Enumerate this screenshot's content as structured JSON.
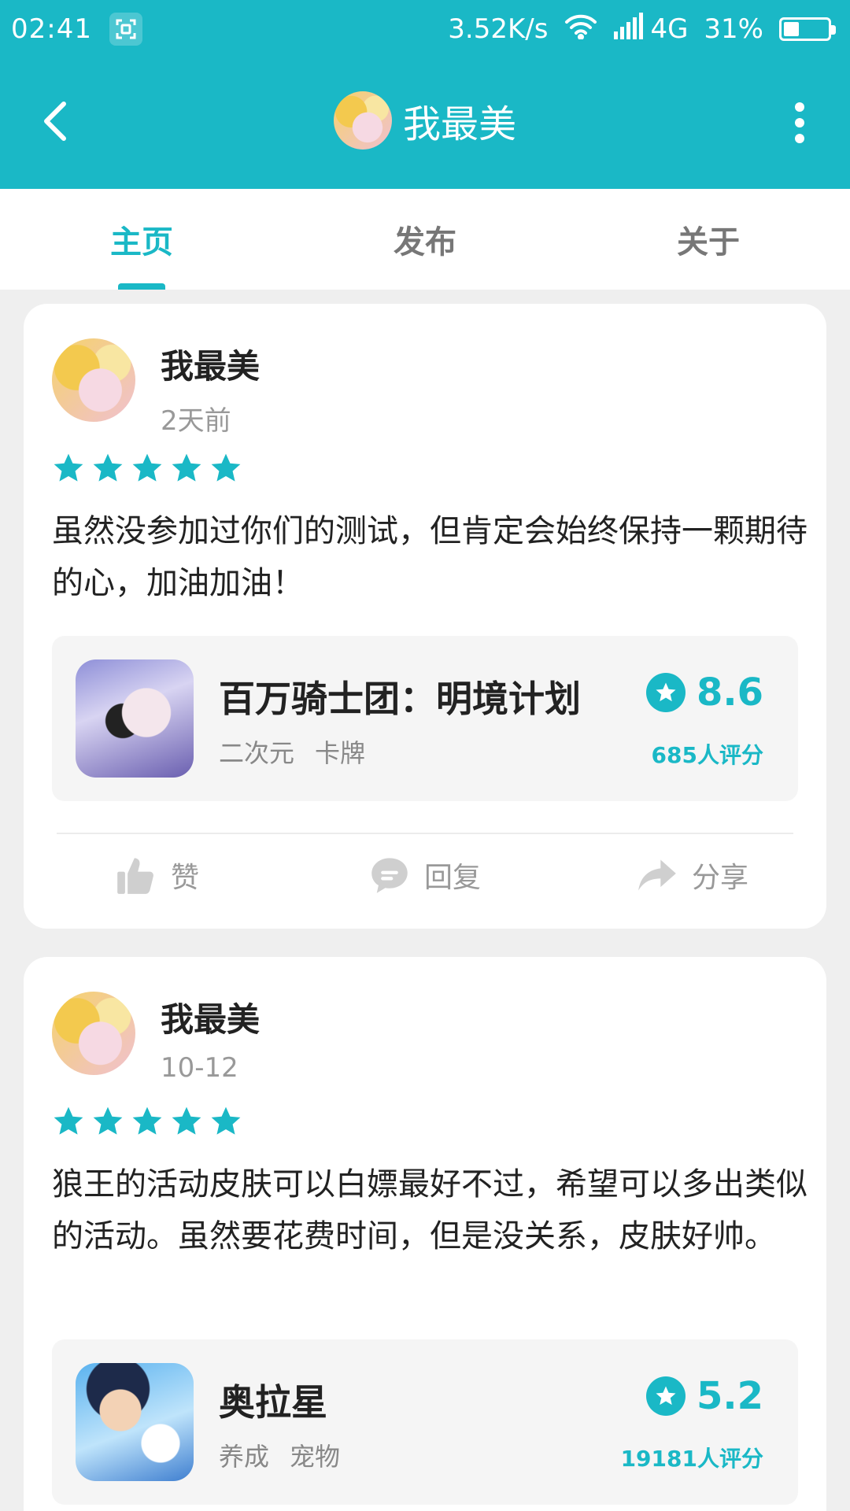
{
  "status_bar": {
    "time": "02:41",
    "speed": "3.52K/s",
    "network": "4G",
    "battery": "31%",
    "battery_level": 0.31
  },
  "header": {
    "title": "我最美"
  },
  "tabs": [
    {
      "label": "主页",
      "active": true
    },
    {
      "label": "发布",
      "active": false
    },
    {
      "label": "关于",
      "active": false
    }
  ],
  "posts": [
    {
      "author": "我最美",
      "time": "2天前",
      "rating_stars": 5,
      "text": "虽然没参加过你们的测试，但肯定会始终保持一颗期待的心，加油加油！",
      "game": {
        "name": "百万骑士团：明境计划",
        "tags": [
          "二次元",
          "卡牌"
        ],
        "score": "8.6",
        "ratings": "685人评分"
      },
      "actions": {
        "like": "赞",
        "reply": "回复",
        "share": "分享"
      }
    },
    {
      "author": "我最美",
      "time": "10-12",
      "rating_stars": 5,
      "text": "狼王的活动皮肤可以白嫖最好不过，希望可以多出类似的活动。虽然要花费时间，但是没关系，皮肤好帅。",
      "game": {
        "name": "奥拉星",
        "tags": [
          "养成",
          "宠物"
        ],
        "score": "5.2",
        "ratings": "19181人评分"
      }
    }
  ],
  "colors": {
    "accent": "#1ab8c6",
    "background": "#efefef"
  }
}
